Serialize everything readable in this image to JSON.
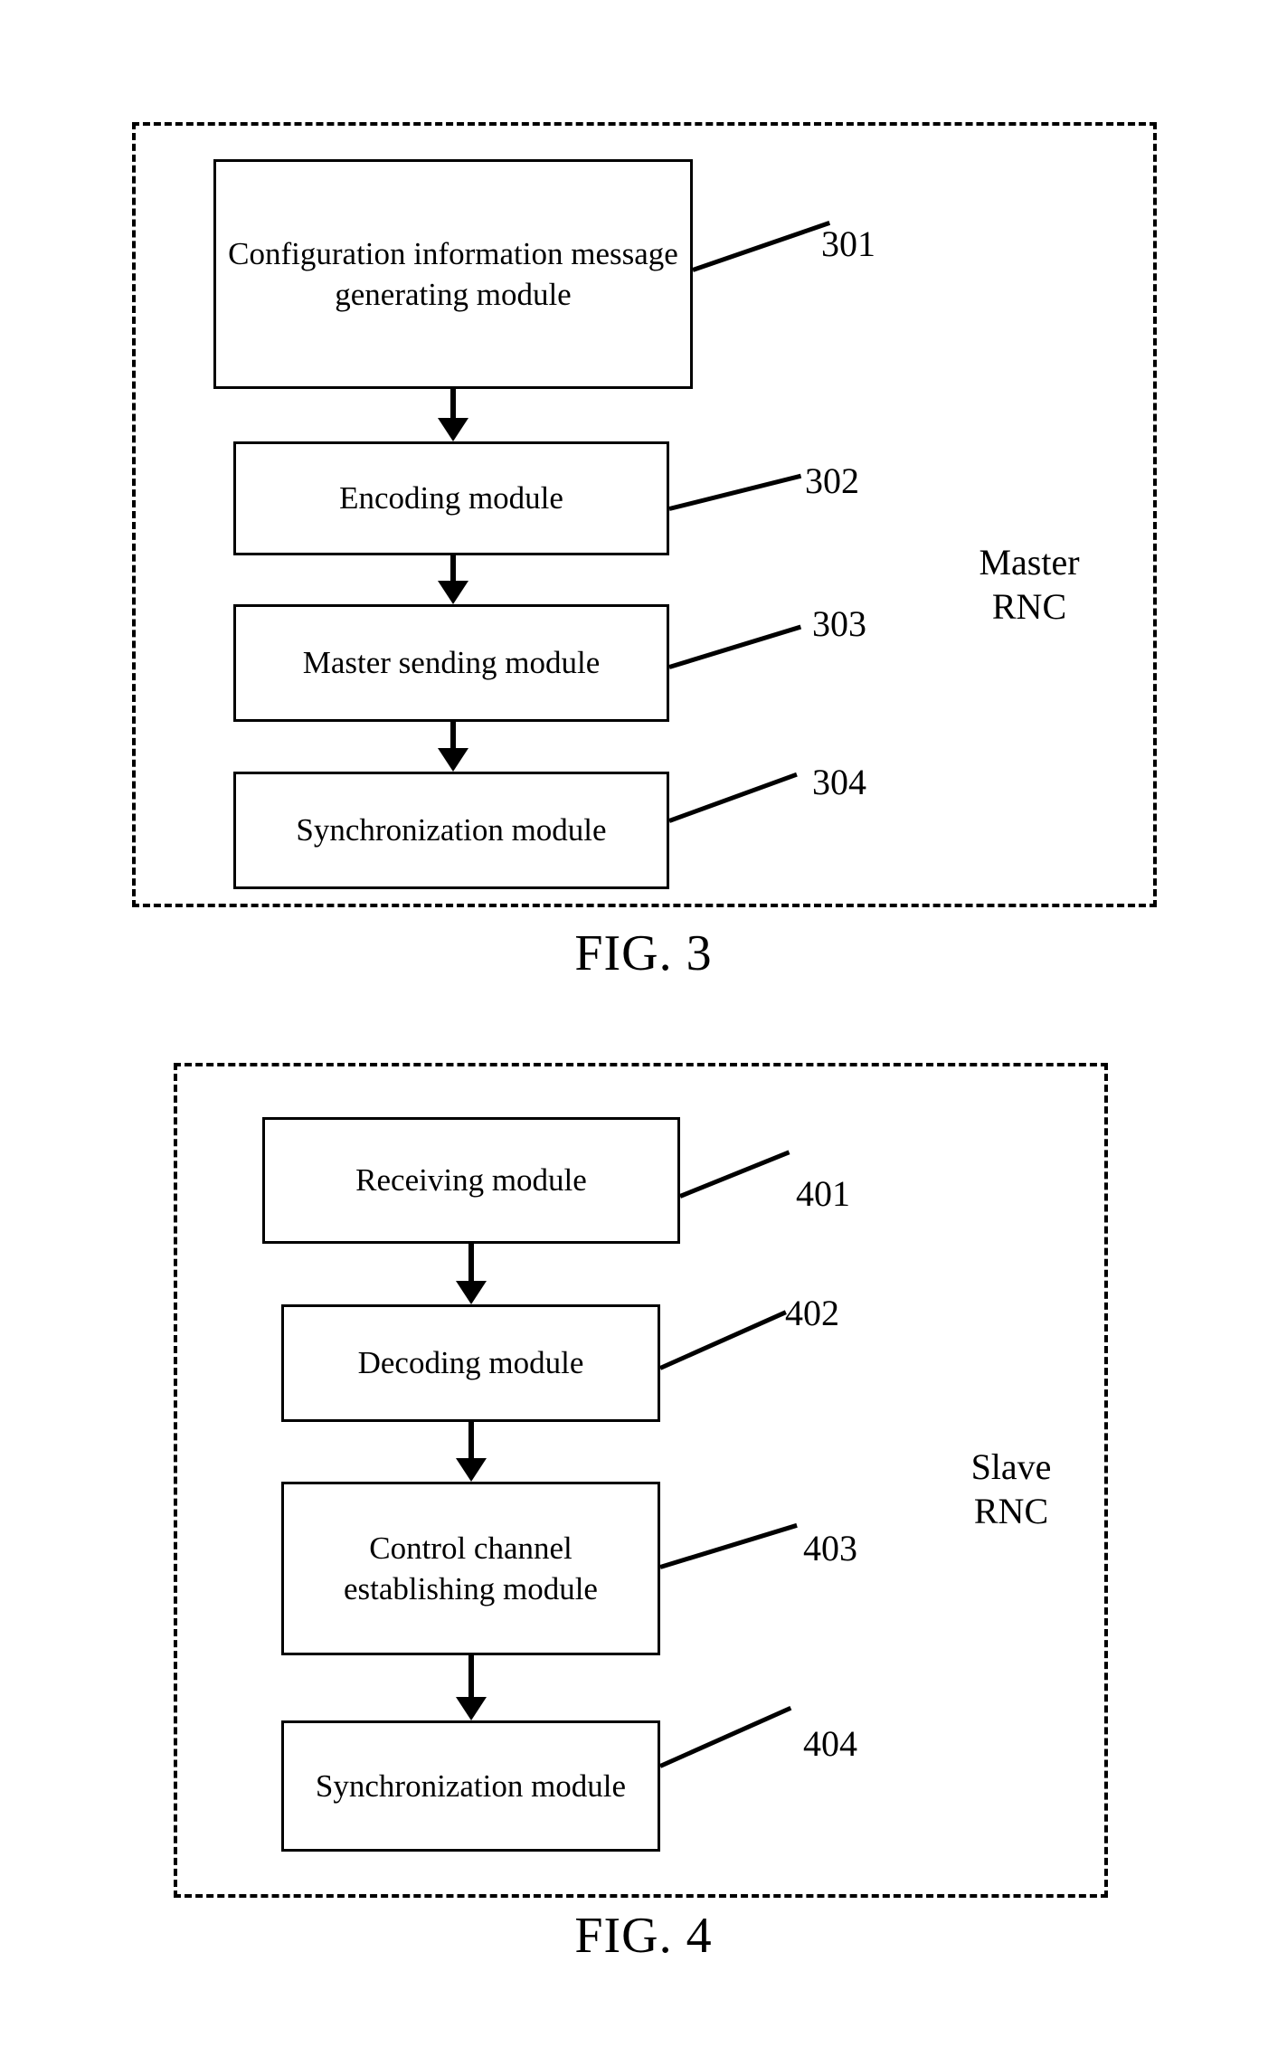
{
  "document": {
    "type": "patent-drawing-sheet",
    "figures": [
      {
        "id": "fig3",
        "caption": "FIG. 3",
        "container_label": "Master\nRNC",
        "boxes": [
          {
            "ref": "301",
            "label": "Configuration information message generating module"
          },
          {
            "ref": "302",
            "label": "Encoding module"
          },
          {
            "ref": "303",
            "label": "Master sending module"
          },
          {
            "ref": "304",
            "label": "Synchronization module"
          }
        ]
      },
      {
        "id": "fig4",
        "caption": "FIG. 4",
        "container_label": "Slave\nRNC",
        "boxes": [
          {
            "ref": "401",
            "label": "Receiving module"
          },
          {
            "ref": "402",
            "label": "Decoding module"
          },
          {
            "ref": "403",
            "label": "Control channel establishing module"
          },
          {
            "ref": "404",
            "label": "Synchronization module"
          }
        ]
      }
    ]
  },
  "colors": {
    "ink": "#000000",
    "paper": "#ffffff"
  }
}
